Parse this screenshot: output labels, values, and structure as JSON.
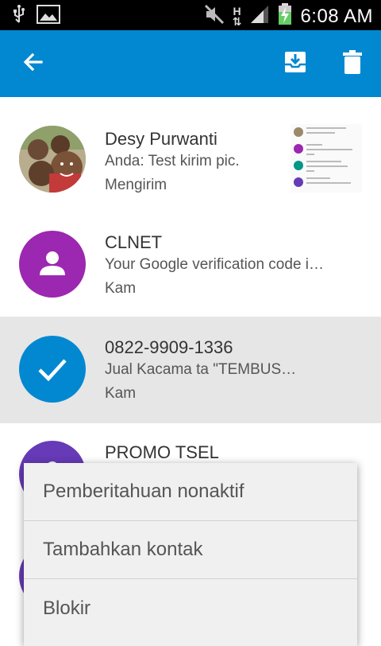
{
  "status_bar": {
    "time": "6:08 AM",
    "network_letter": "H",
    "icons": [
      "usb-icon",
      "image-icon",
      "mute-icon",
      "signal-icon",
      "battery-charging-icon"
    ]
  },
  "app_bar": {
    "color": "#0288d1",
    "icons": [
      "back-arrow-icon",
      "archive-icon",
      "trash-icon"
    ]
  },
  "conversations": [
    {
      "name": "Desy Purwanti",
      "snippet": "Anda: Test kirim pic.",
      "status": "Mengirim",
      "avatar": "photo",
      "selected": false,
      "has_thumbnail": true
    },
    {
      "name": "CLNET",
      "snippet": "Your Google verification code i…",
      "status": "Kam",
      "avatar_color": "#9c27b0",
      "avatar": "person-icon",
      "selected": false
    },
    {
      "name": "0822-9909-1336",
      "snippet": "Jual Kacama ta \"TEMBUS…",
      "status": "Kam",
      "avatar_color": "#0288d1",
      "avatar": "check-icon",
      "selected": true
    },
    {
      "name": "PROMO TSEL",
      "snippet": "",
      "status": "",
      "avatar_color": "#673ab7",
      "avatar": "person-icon",
      "selected": false
    }
  ],
  "context_menu": {
    "items": [
      "Pemberitahuan nonaktif",
      "Tambahkan kontak",
      "Blokir"
    ]
  }
}
